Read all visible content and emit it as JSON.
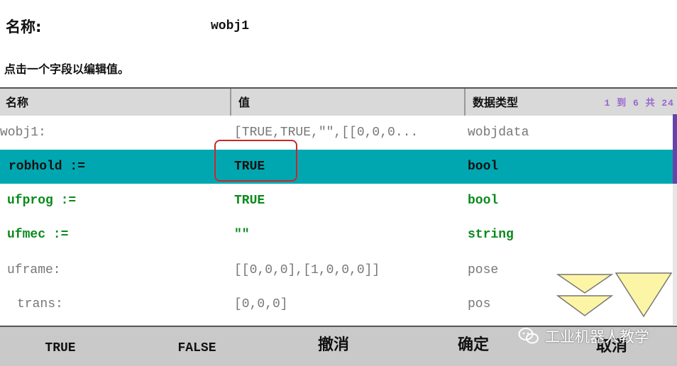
{
  "header": {
    "name_label": "名称:",
    "name_value": "wobj1",
    "instruction": "点击一个字段以编辑值。"
  },
  "table": {
    "columns": [
      "名称",
      "值",
      "数据类型"
    ],
    "pager": "1 到 6 共 24",
    "rows": [
      {
        "name": "wobj1:",
        "value": "[TRUE,TRUE,\"\",[[0,0,0...",
        "type": "wobjdata",
        "style": "gray"
      },
      {
        "name": "robhold :=",
        "value": "TRUE",
        "type": "bool",
        "style": "selected"
      },
      {
        "name": "ufprog :=",
        "value": "TRUE",
        "type": "bool",
        "style": "green"
      },
      {
        "name": "ufmec :=",
        "value": "\"\"",
        "type": "string",
        "style": "green"
      },
      {
        "name": "uframe:",
        "value": "[[0,0,0],[1,0,0,0]]",
        "type": "pose",
        "style": "gray"
      },
      {
        "name": "trans:",
        "value": "[0,0,0]",
        "type": "pos",
        "style": "gray"
      }
    ]
  },
  "buttons": {
    "true": "TRUE",
    "false": "FALSE",
    "undo": "撤消",
    "ok": "确定",
    "cancel": "取消"
  },
  "watermark": "工业机器人教学",
  "scroll": {
    "page_down_icon": "double-chevron-down-icon",
    "end_icon": "chevron-down-icon",
    "arrow_color": "#fdf5a6"
  },
  "colors": {
    "selected_row": "#00a7b1",
    "editable_text": "#0a8a1c",
    "highlight_box": "#c62a2a",
    "pager_text": "#9966cc"
  }
}
